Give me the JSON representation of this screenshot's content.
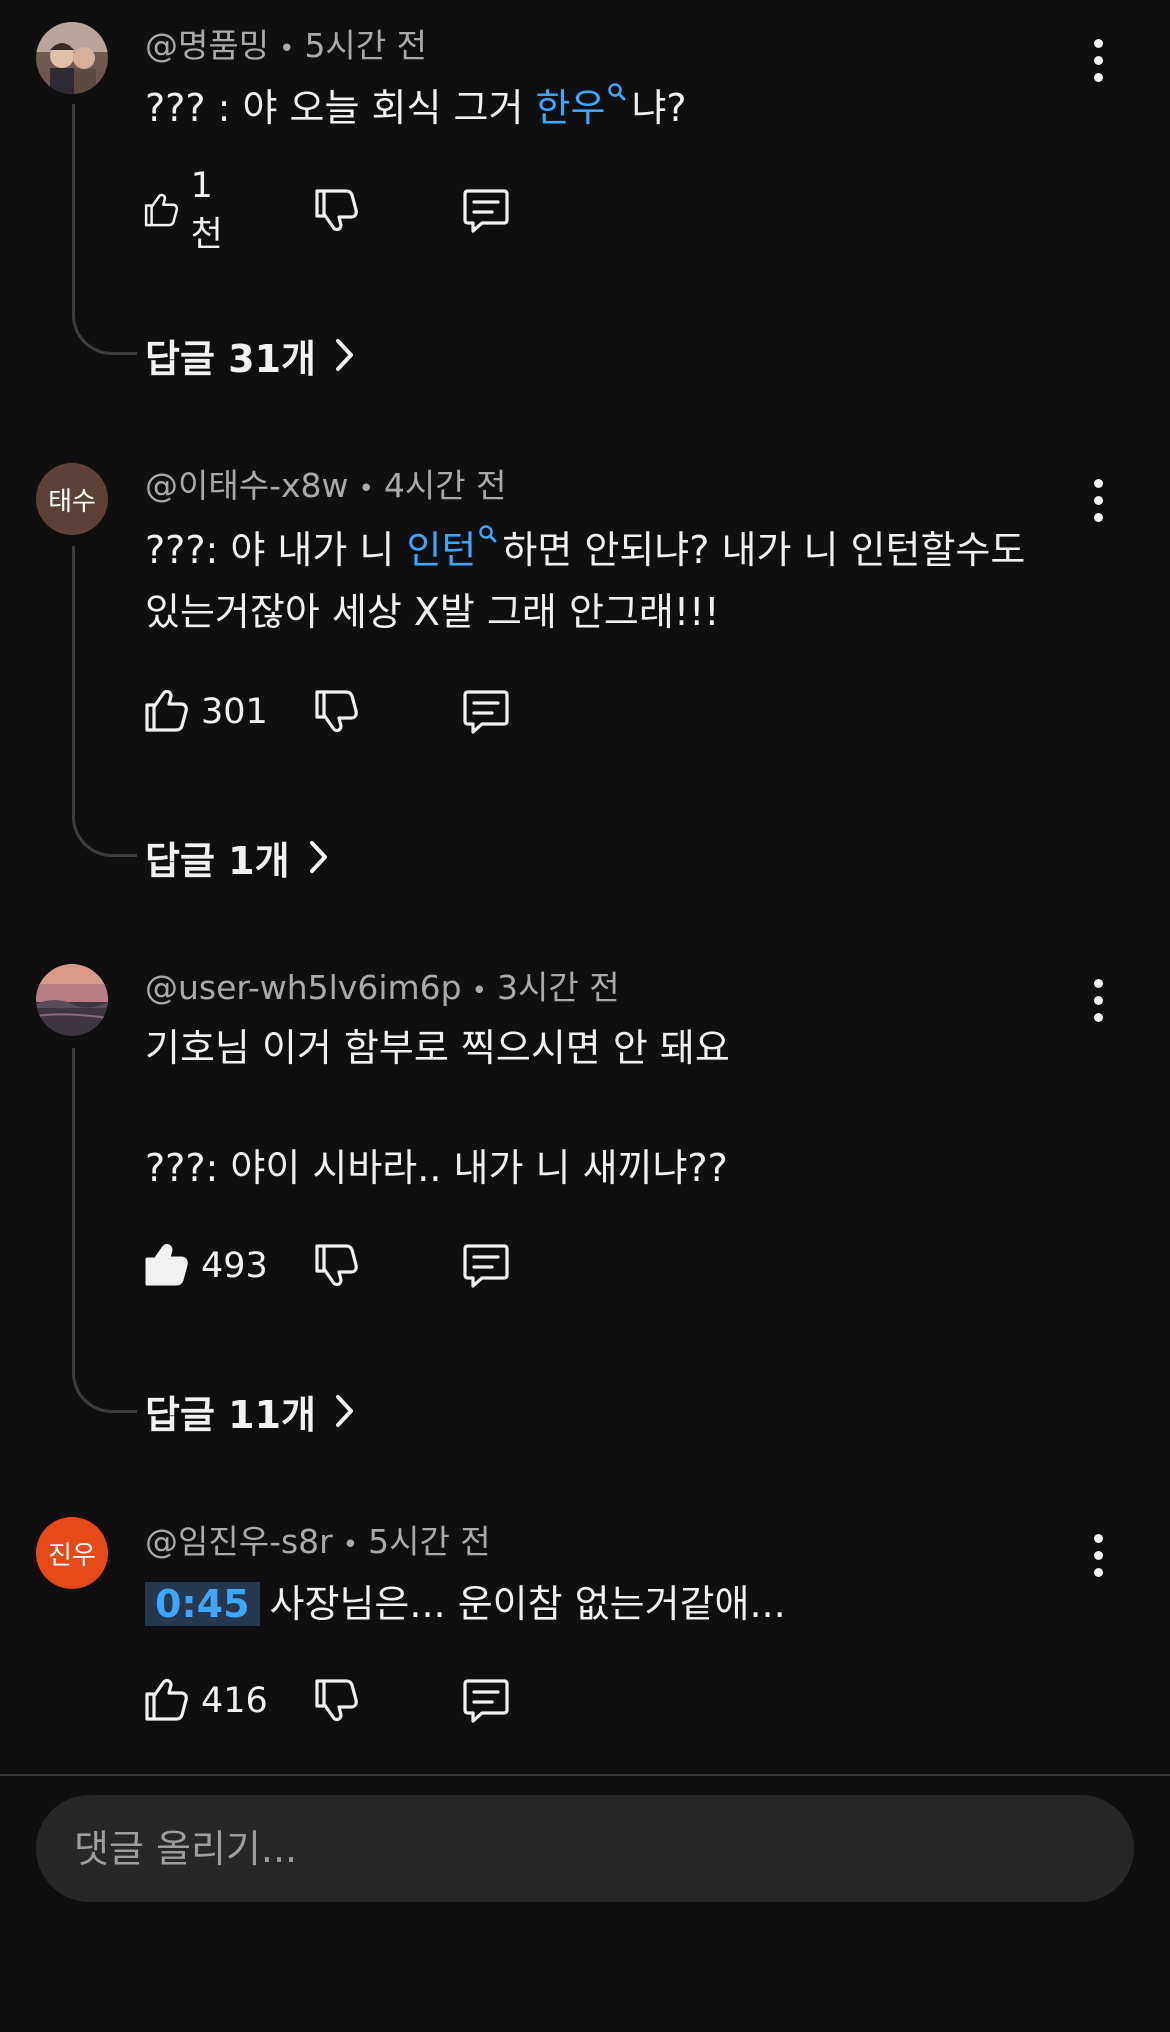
{
  "comments": [
    {
      "avatar_text": "",
      "avatar_color": "#8a6a5a",
      "author": "@명품밍",
      "time": "5시간 전",
      "text_before": "??? : 야 오늘 회식 그거 ",
      "link": "한우",
      "text_after": "냐?",
      "likes": "1천",
      "replies": "답글 31개"
    },
    {
      "avatar_text": "태수",
      "avatar_color": "#5d4037",
      "author": "@이태수-x8w",
      "time": "4시간 전",
      "text_before": "???: 야 내가 니 ",
      "link": "인턴",
      "text_after": "하면 안되냐? 내가 니 인턴할수도",
      "line2": "있는거잖아 세상 X발 그래 안그래!!!",
      "likes": "301",
      "replies": "답글 1개"
    },
    {
      "avatar_text": "",
      "avatar_color": "#c98a7a",
      "author": "@user-wh5lv6im6p",
      "time": "3시간 전",
      "line1": "기호님 이거 함부로 찍으시면 안 돼요",
      "line2": "???: 야이 시바라.. 내가 니 새끼냐??",
      "likes": "493",
      "liked": true,
      "replies": "답글 11개"
    },
    {
      "avatar_text": "진우",
      "avatar_color": "#e64a19",
      "author": "@임진우-s8r",
      "time": "5시간 전",
      "timestamp": "0:45",
      "text": "사장님은... 운이참 없는거같애...",
      "likes": "416"
    }
  ],
  "composer": {
    "placeholder": "댓글 올리기..."
  },
  "icons": {
    "like": "thumbs-up-icon",
    "dislike": "thumbs-down-icon",
    "reply": "comment-icon",
    "more": "more-vert-icon",
    "chevron": "chevron-right-icon",
    "search": "search-icon"
  },
  "colors": {
    "background": "#0f0f0f",
    "link": "#3ea6ff",
    "meta": "#aaaaaa",
    "input_bg": "#272727"
  }
}
